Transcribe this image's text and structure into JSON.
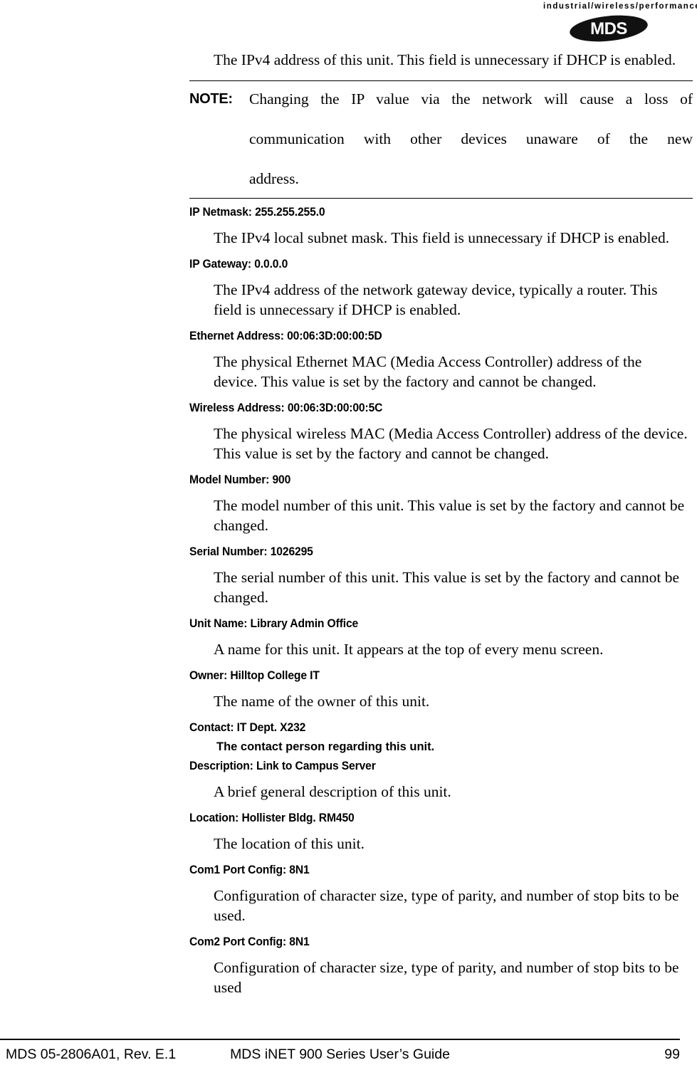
{
  "header": {
    "tagline": "industrial/wireless/performance",
    "logo_text": "MDS"
  },
  "intro": {
    "text": "The IPv4 address of this unit. This field is unnecessary if DHCP is enabled."
  },
  "note": {
    "label": "NOTE:",
    "line1": "Changing the IP value via the network will cause a loss of",
    "line2": "communication with other devices unaware of the new",
    "line3": "address."
  },
  "sections": [
    {
      "heading": "IP Netmask: 255.255.255.0",
      "body": "The IPv4 local subnet mask. This field is unnecessary if DHCP is enabled.",
      "style": "serif"
    },
    {
      "heading": "IP Gateway: 0.0.0.0",
      "body": "The IPv4 address of the network gateway device, typically a router. This field is unnecessary if DHCP is enabled.",
      "style": "serif"
    },
    {
      "heading": "Ethernet Address: 00:06:3D:00:00:5D",
      "body": "The physical Ethernet MAC (Media Access Controller) address of the device. This value is set by the factory and cannot be changed.",
      "style": "serif"
    },
    {
      "heading": "Wireless Address: 00:06:3D:00:00:5C",
      "body": "The physical wireless MAC (Media Access Controller) address of the device. This value is set by the factory and cannot be changed.",
      "style": "serif"
    },
    {
      "heading": "Model Number: 900",
      "body": "The model number of this unit. This value is set by the factory and cannot be changed.",
      "style": "serif"
    },
    {
      "heading": "Serial Number: 1026295",
      "body": "The serial number of this unit. This value is set by the factory and cannot be changed.",
      "style": "serif"
    },
    {
      "heading": "Unit Name: Library Admin Office",
      "body": "A name for this unit. It appears at the top of every menu screen.",
      "style": "serif"
    },
    {
      "heading": "Owner: Hilltop College IT",
      "body": "The name of the owner of this unit.",
      "style": "serif"
    },
    {
      "heading": "Contact: IT Dept. X232",
      "body": "The contact person regarding this unit.",
      "style": "bold-sans"
    },
    {
      "heading": "Description: Link to Campus Server",
      "body": "A brief general description of this unit.",
      "style": "serif"
    },
    {
      "heading": "Location: Hollister Bldg. RM450",
      "body": "The location of this unit.",
      "style": "serif"
    },
    {
      "heading": "Com1 Port Config: 8N1",
      "body": "Configuration of character size, type of parity, and number of stop bits to be used.",
      "style": "serif"
    },
    {
      "heading": "Com2 Port Config: 8N1",
      "body": "Configuration of character size, type of parity, and number of stop bits to be used",
      "style": "serif"
    }
  ],
  "footer": {
    "doc_id": "MDS 05-2806A01, Rev. E.1",
    "title": "MDS iNET 900 Series User’s Guide",
    "page_number": "99"
  }
}
